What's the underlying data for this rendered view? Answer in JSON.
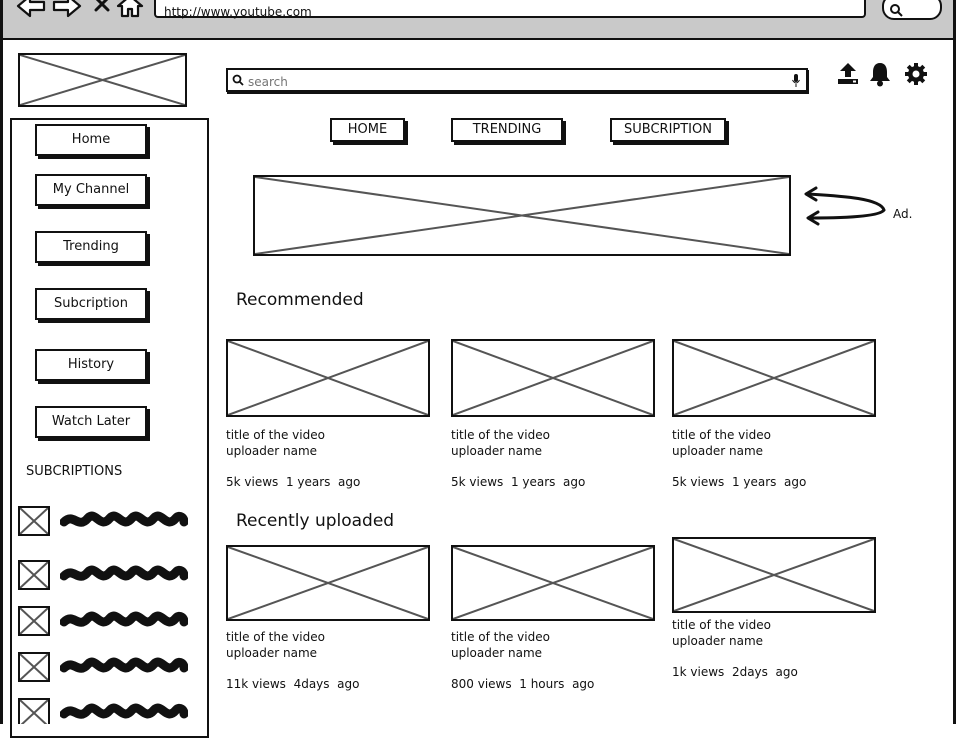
{
  "browser": {
    "url": "http://www.youtube.com"
  },
  "header": {
    "search_placeholder": "search",
    "icons": [
      "upload-icon",
      "bell-icon",
      "gear-icon"
    ]
  },
  "top_nav": {
    "items": [
      "HOME",
      "TRENDING",
      "SUBCRIPTION"
    ]
  },
  "ad": {
    "label": "Ad."
  },
  "sidebar": {
    "items": [
      "Home",
      "My Channel",
      "Trending",
      "Subcription",
      "History",
      "Watch Later"
    ],
    "subscriptions_heading": "SUBCRIPTIONS",
    "subscription_count_visible": 5
  },
  "sections": [
    {
      "title": "Recommended",
      "videos": [
        {
          "title": "title of the video",
          "uploader": "uploader name",
          "views": "5k views",
          "age": "1 years  ago"
        },
        {
          "title": "title of the video",
          "uploader": "uploader name",
          "views": "5k views",
          "age": "1 years  ago"
        },
        {
          "title": "title of the video",
          "uploader": "uploader name",
          "views": "5k views",
          "age": "1 years  ago"
        }
      ]
    },
    {
      "title": "Recently uploaded",
      "videos": [
        {
          "title": "title of the video",
          "uploader": "uploader name",
          "views": "11k views",
          "age": "4days  ago"
        },
        {
          "title": "title of the video",
          "uploader": "uploader name",
          "views": "800 views",
          "age": "1 hours  ago"
        },
        {
          "title": "title of the video",
          "uploader": "uploader name",
          "views": "1k views",
          "age": "2days  ago"
        }
      ]
    }
  ]
}
